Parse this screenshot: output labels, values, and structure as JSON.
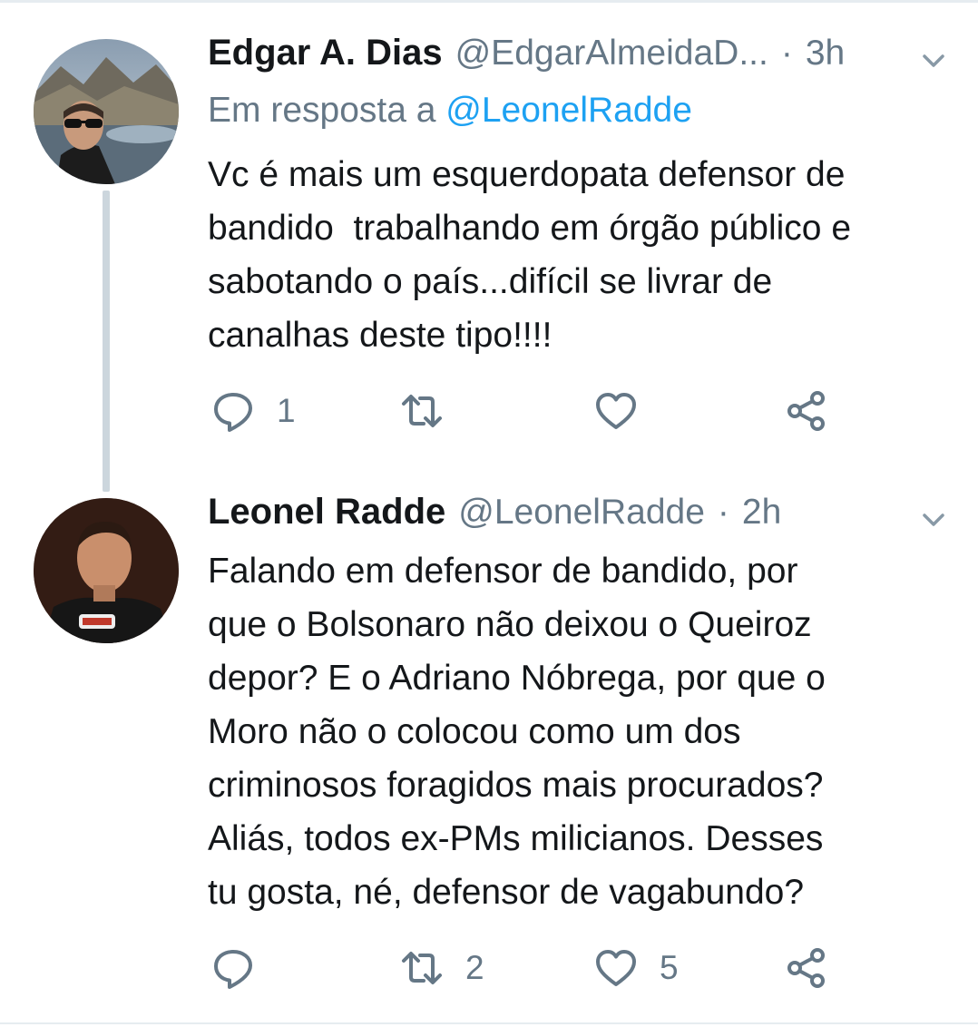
{
  "tweets": [
    {
      "name": "Edgar A. Dias",
      "handle": "@EdgarAlmeidaD...",
      "dot": "·",
      "time": "3h",
      "reply_prefix": "Em resposta a ",
      "reply_mention": "@LeonelRadde",
      "text": "Vc é mais um esquerdopata defensor de\nbandido  trabalhando em órgão público e\nsabotando o país...difícil se livrar de\ncanalhas deste tipo!!!!",
      "reply_count": "1",
      "retweet_count": "",
      "like_count": ""
    },
    {
      "name": "Leonel Radde",
      "handle": "@LeonelRadde",
      "dot": "·",
      "time": "2h",
      "text": "Falando em defensor de bandido, por\nque o Bolsonaro não deixou o Queiroz\ndepor? E o Adriano Nóbrega, por que o\nMoro não o colocou como um dos\ncriminosos foragidos mais procurados?\nAliás, todos ex-PMs milicianos. Desses\ntu gosta, né, defensor de vagabundo?",
      "reply_count": "",
      "retweet_count": "2",
      "like_count": "5"
    }
  ],
  "icons": [
    "reply-icon",
    "retweet-icon",
    "like-icon",
    "share-icon",
    "chevron-down-icon"
  ],
  "colors": {
    "text": "#14171a",
    "secondary": "#657786",
    "link": "#1da1f2",
    "thread_line": "#ccd6dd"
  }
}
